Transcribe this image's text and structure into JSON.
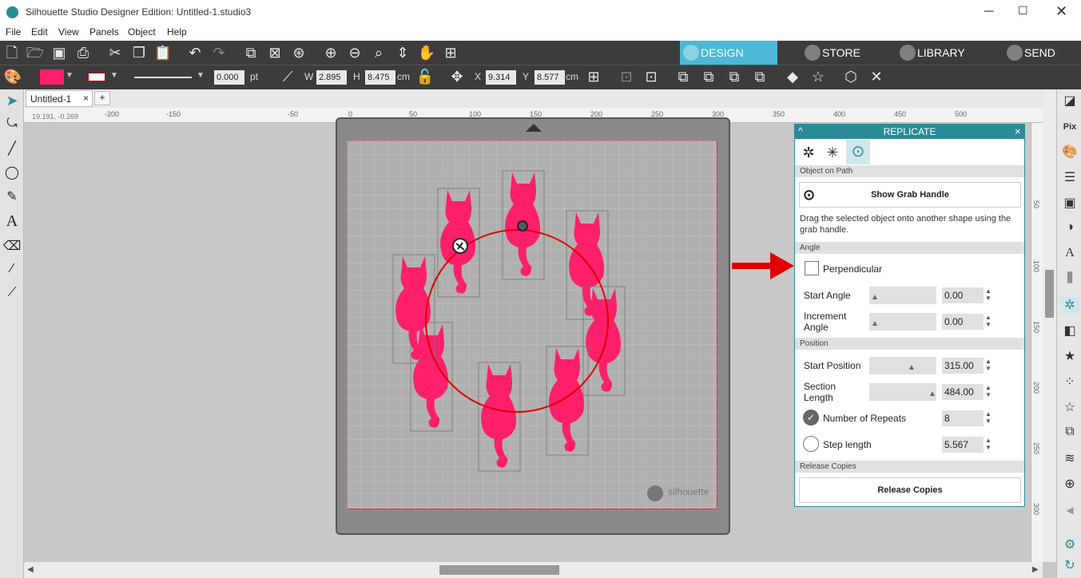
{
  "window": {
    "title": "Silhouette Studio Designer Edition: Untitled-1.studio3"
  },
  "menu": [
    "File",
    "Edit",
    "View",
    "Panels",
    "Object",
    "Help"
  ],
  "nav_tabs": [
    {
      "label": "DESIGN",
      "active": true
    },
    {
      "label": "STORE"
    },
    {
      "label": "LIBRARY"
    },
    {
      "label": "SEND"
    }
  ],
  "props": {
    "line_width": "0.000",
    "line_unit": "pt",
    "w_label": "W",
    "w_value": "2.895",
    "h_label": "H",
    "h_value": "8.475",
    "size_unit": "cm",
    "x_label": "X",
    "x_value": "9.314",
    "y_label": "Y",
    "y_value": "8.577",
    "pos_unit": "cm",
    "fill_color": "#ff1f6b",
    "line_color": "#cc0000"
  },
  "doc_tab": {
    "label": "Untitled-1",
    "close": "×",
    "add": "+"
  },
  "ruler": {
    "coords": "19.191, -0.269",
    "h_ticks": [
      "-200",
      "-150",
      "-50",
      "0",
      "50",
      "100",
      "150",
      "200",
      "250",
      "300",
      "350",
      "400",
      "450",
      "500"
    ],
    "v_ticks": [
      "50",
      "100",
      "150",
      "200",
      "250",
      "300"
    ]
  },
  "mat": {
    "brand": "silhouette"
  },
  "panel": {
    "title": "REPLICATE",
    "close": "×",
    "collapse": "^",
    "object_on_path": "Object on Path",
    "show_grab_handle": "Show Grab Handle",
    "instruction": "Drag the selected object onto another shape using the grab handle.",
    "angle_section": "Angle",
    "perpendicular": "Perpendicular",
    "perpendicular_checked": false,
    "start_angle_label": "Start Angle",
    "start_angle": "0.00",
    "increment_angle_label": "Increment Angle",
    "increment_angle": "0.00",
    "position_section": "Position",
    "start_position_label": "Start Position",
    "start_position": "315.00",
    "section_length_label": "Section Length",
    "section_length": "484.00",
    "number_of_repeats_label": "Number of Repeats",
    "number_of_repeats": "8",
    "repeats_selected": true,
    "step_length_label": "Step length",
    "step_length": "5.567",
    "release_section": "Release Copies",
    "release_button": "Release Copies"
  },
  "colors": {
    "accent": "#2a8c97",
    "cat": "#ff1f6b",
    "circle": "#e00000",
    "arrow": "#e00000"
  }
}
